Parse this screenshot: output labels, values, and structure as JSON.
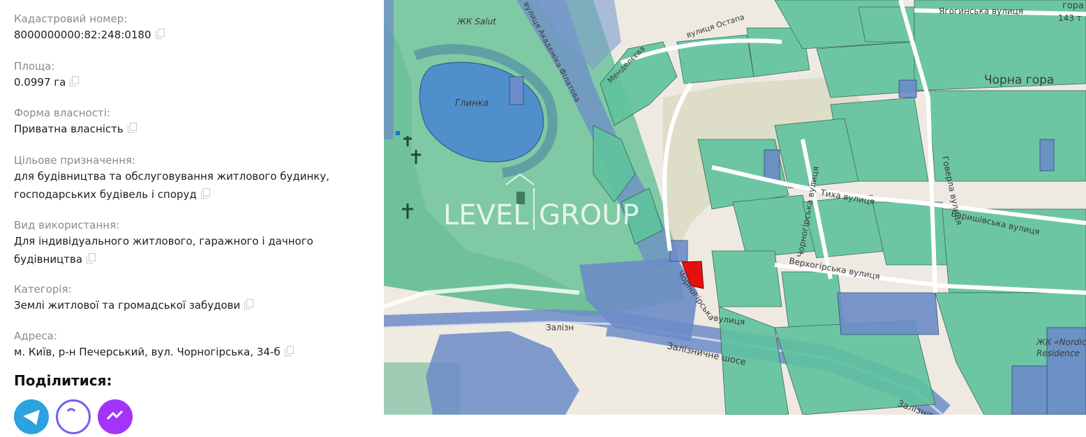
{
  "details": {
    "cadastral": {
      "label": "Кадастровий номер:",
      "value": "8000000000:82:248:0180"
    },
    "area": {
      "label": "Площа:",
      "value": "0.0997 га"
    },
    "ownership": {
      "label": "Форма власності:",
      "value": "Приватна власність"
    },
    "purpose": {
      "label": "Цільове призначення:",
      "line1": "для будівництва та обслуговування житлового будинку,",
      "line2": "господарських будівель і споруд"
    },
    "usage": {
      "label": "Вид використання:",
      "line1": "Для індивідуального житлового, гаражного і дачного",
      "line2": "будівництва"
    },
    "category": {
      "label": "Категорія:",
      "value": "Землі житлової та громадської забудови"
    },
    "address": {
      "label": "Адреса:",
      "value": "м. Київ, р-н Печерський, вул. Чорногірська, 34-б"
    }
  },
  "share": {
    "title": "Поділитися:",
    "buttons": [
      {
        "name": "telegram",
        "color": "#2aa3df"
      },
      {
        "name": "viber",
        "color": "#7360f2"
      },
      {
        "name": "messenger",
        "color": "#a334fa"
      }
    ]
  },
  "map": {
    "watermark_1": "LEVEL",
    "watermark_2": "GROUP",
    "labels": {
      "zhk_salut": "ЖК Salut",
      "glynka": "Глинка",
      "akad_filatova": "вулиця Академіка Філатова",
      "ostapa": "вулиця Остапа",
      "mendeleeva": "Менделєєва",
      "yahotynska": "Ягогинська вулиця",
      "num_143": "143 т",
      "gora": "гора",
      "chorna_gora": "Чорна гора",
      "tykha": "Тиха вулиця",
      "chornohirska": "Чорногірська вулиця",
      "chornohirska_2": "Чорногірська",
      "vulytsia": "вулиця",
      "hoverlia": "Говерла вулиця",
      "baryshivska": "Баришівська вулиця",
      "verkhohirska": "Верхогірська вулиця",
      "zaliz_short": "Залізн",
      "zaliz_shose": "Залізничне шосе",
      "zaliznychne": "Залізничне",
      "zhk_nordic_1": "ЖК «Nordic",
      "zhk_nordic_2": "Residence"
    },
    "colors": {
      "green": "#5fc39e",
      "blue": "#6d8cc8",
      "parcel": "#e60f0f"
    }
  }
}
